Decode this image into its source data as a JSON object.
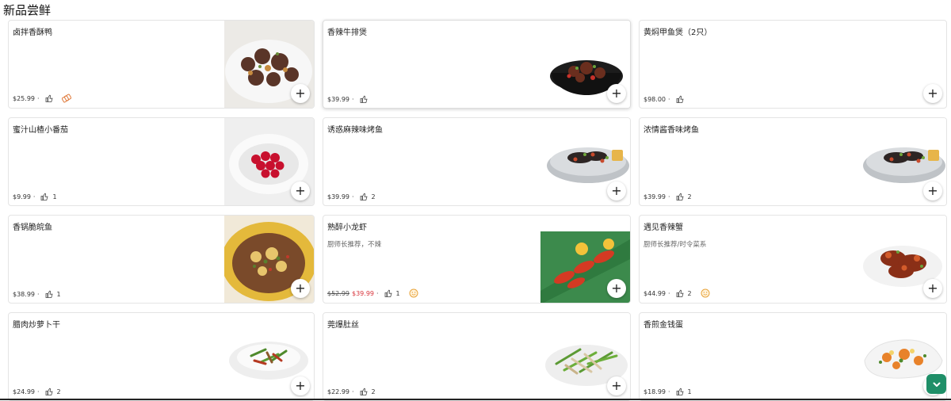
{
  "section": {
    "title": "新品尝鲜"
  },
  "items": [
    {
      "name": "卤拌香酥鸭",
      "price": "$25.99",
      "original_price": "",
      "likes": "",
      "description": "",
      "promo": "coupon"
    },
    {
      "name": "香辣牛排煲",
      "price": "$39.99",
      "original_price": "",
      "likes": "",
      "description": "",
      "promo": ""
    },
    {
      "name": "黄焖甲鱼煲（2只）",
      "price": "$98.00",
      "original_price": "",
      "likes": "",
      "description": "",
      "promo": ""
    },
    {
      "name": "蜜汁山楂小番茄",
      "price": "$9.99",
      "original_price": "",
      "likes": "1",
      "description": "",
      "promo": ""
    },
    {
      "name": "诱惑麻辣味烤鱼",
      "price": "$39.99",
      "original_price": "",
      "likes": "2",
      "description": "",
      "promo": ""
    },
    {
      "name": "浓情酱香味烤鱼",
      "price": "$39.99",
      "original_price": "",
      "likes": "2",
      "description": "",
      "promo": ""
    },
    {
      "name": "香锅脆皖鱼",
      "price": "$38.99",
      "original_price": "",
      "likes": "1",
      "description": "",
      "promo": ""
    },
    {
      "name": "熟醉小龙虾",
      "price": "$39.99",
      "original_price": "$52.99",
      "likes": "1",
      "description": "厨师长推荐，不辣",
      "promo": "smile"
    },
    {
      "name": "遇见香辣蟹",
      "price": "$44.99",
      "original_price": "",
      "likes": "2",
      "description": "厨师长推荐/时令菜系",
      "promo": "smile"
    },
    {
      "name": "腊肉炒萝卜干",
      "price": "$24.99",
      "original_price": "",
      "likes": "2",
      "description": "",
      "promo": ""
    },
    {
      "name": "莞爆肚丝",
      "price": "$22.99",
      "original_price": "",
      "likes": "2",
      "description": "",
      "promo": ""
    },
    {
      "name": "香煎金钱蛋",
      "price": "$18.99",
      "original_price": "",
      "likes": "1",
      "description": "",
      "promo": ""
    }
  ],
  "ui": {
    "add_symbol": "+",
    "price_separator": "·"
  },
  "colors": {
    "accent": "#1f8f68",
    "sale": "#d9363e",
    "promo": "#e8a33b"
  }
}
